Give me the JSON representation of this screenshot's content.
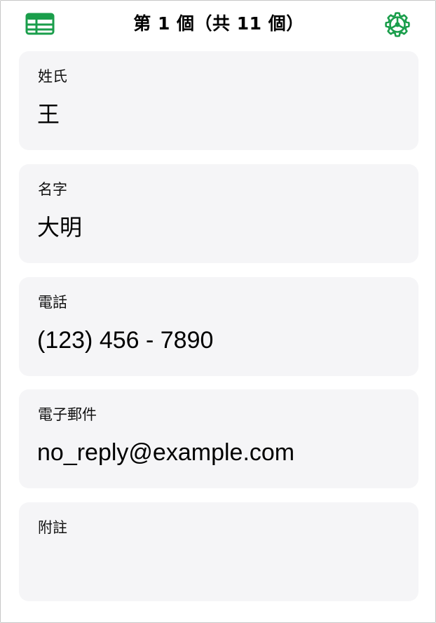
{
  "toolbar": {
    "title": "第 1 個（共 11 個）",
    "table_icon": "table-icon",
    "settings_icon": "gear-icon",
    "accent_color": "#1a9e4b"
  },
  "fields": [
    {
      "label": "姓氏",
      "value": "王"
    },
    {
      "label": "名字",
      "value": "大明"
    },
    {
      "label": "電話",
      "value": "(123) 456 - 7890"
    },
    {
      "label": "電子郵件",
      "value": "no_reply@example.com"
    },
    {
      "label": "附註",
      "value": ""
    }
  ]
}
